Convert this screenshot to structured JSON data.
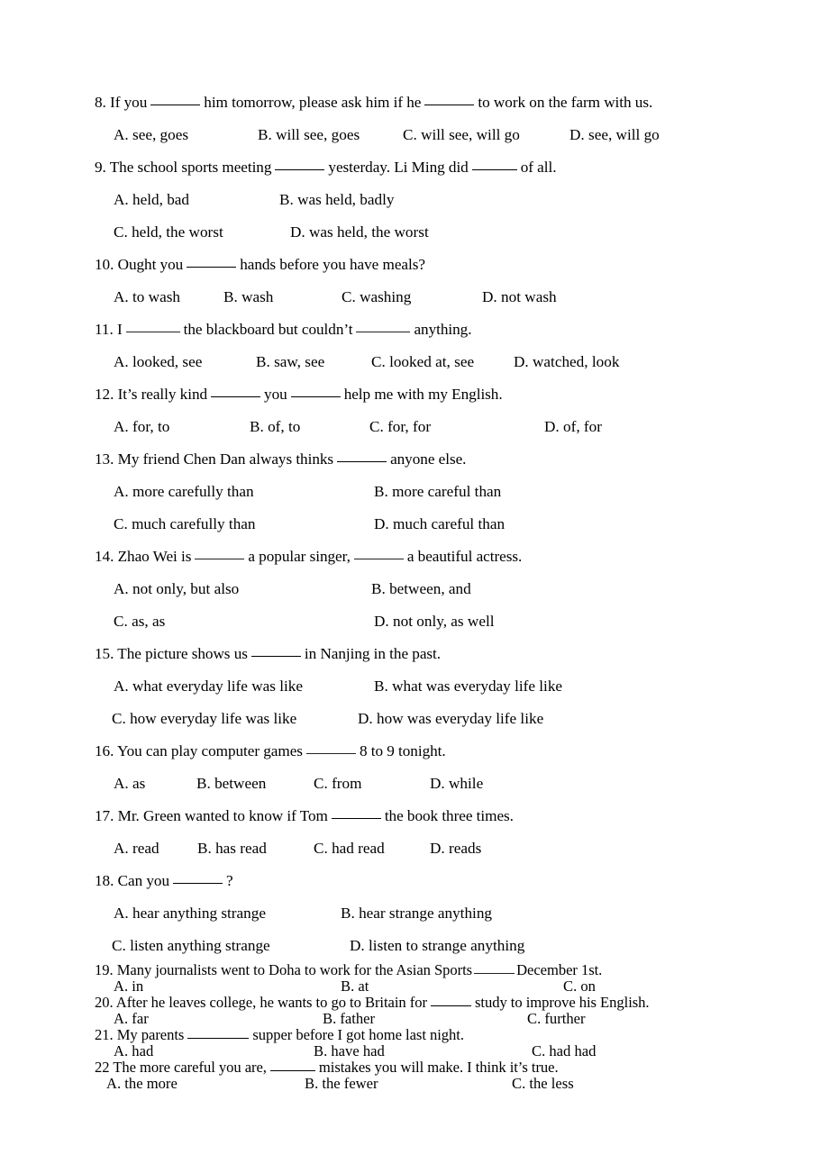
{
  "document": {
    "type": "english-grammar-multiple-choice-worksheet",
    "page_background": "#ffffff",
    "text_color": "#000000"
  },
  "questions": [
    {
      "number": "8.",
      "stem_before": "If you",
      "stem_mid": "him tomorrow, please ask him if he",
      "stem_after": "to work on the farm with us.",
      "layout": "four-column",
      "options": [
        {
          "label": "A.",
          "text": "see, goes"
        },
        {
          "label": "B.",
          "text": "will see, goes"
        },
        {
          "label": "C.",
          "text": "will see, will go"
        },
        {
          "label": "D.",
          "text": "see, will go"
        }
      ]
    },
    {
      "number": "9.",
      "stem_before": "The school sports meeting",
      "stem_mid": "yesterday. Li Ming did",
      "stem_after": "of all.",
      "layout": "two-column-narrow",
      "options": [
        {
          "label": "A.",
          "text": "held, bad"
        },
        {
          "label": "B.",
          "text": "was held, badly"
        },
        {
          "label": "C.",
          "text": "held, the worst"
        },
        {
          "label": "D.",
          "text": "was held, the worst"
        }
      ]
    },
    {
      "number": "10.",
      "stem_before": "Ought you",
      "stem_after": "hands before you have meals?",
      "layout": "four-column",
      "options": [
        {
          "label": "A.",
          "text": "to wash"
        },
        {
          "label": "B.",
          "text": "wash"
        },
        {
          "label": "C.",
          "text": "washing"
        },
        {
          "label": "D.",
          "text": "not wash"
        }
      ]
    },
    {
      "number": "11.",
      "stem_before": "I",
      "stem_mid": "the blackboard but couldn’t",
      "stem_after": "anything.",
      "layout": "four-column",
      "options": [
        {
          "label": "A.",
          "text": "looked, see"
        },
        {
          "label": "B.",
          "text": "saw, see"
        },
        {
          "label": "C.",
          "text": "looked at, see"
        },
        {
          "label": "D.",
          "text": "watched, look"
        }
      ]
    },
    {
      "number": "12.",
      "stem_before": "It’s really kind",
      "stem_mid": "you",
      "stem_after": "help me with my English.",
      "layout": "four-column",
      "options": [
        {
          "label": "A.",
          "text": "for, to"
        },
        {
          "label": "B.",
          "text": "of, to"
        },
        {
          "label": "C.",
          "text": "for, for"
        },
        {
          "label": "D.",
          "text": "of, for"
        }
      ]
    },
    {
      "number": "13.",
      "stem_before": "My friend Chen Dan always thinks",
      "stem_after": "anyone else.",
      "layout": "two-column-wide",
      "options": [
        {
          "label": "A.",
          "text": "more carefully than"
        },
        {
          "label": "B.",
          "text": "more careful than"
        },
        {
          "label": "C.",
          "text": "much carefully than"
        },
        {
          "label": "D.",
          "text": "much careful than"
        }
      ]
    },
    {
      "number": "14.",
      "stem_before": "Zhao Wei is",
      "stem_mid": "a popular singer,",
      "stem_after": "a beautiful actress.",
      "layout": "two-column-wide",
      "options": [
        {
          "label": "A.",
          "text": "not only, but also"
        },
        {
          "label": "B.",
          "text": "between, and"
        },
        {
          "label": "C.",
          "text": "as, as"
        },
        {
          "label": "D.",
          "text": "not only, as well"
        }
      ]
    },
    {
      "number": "15.",
      "stem_before": "The picture shows us",
      "stem_after": "in Nanjing in the past.",
      "layout": "two-column-wide",
      "options": [
        {
          "label": "A.",
          "text": "what everyday life was like"
        },
        {
          "label": "B.",
          "text": "what was everyday life like"
        },
        {
          "label": "C.",
          "text": "how everyday life was like"
        },
        {
          "label": "D.",
          "text": "how was everyday life like"
        }
      ]
    },
    {
      "number": "16.",
      "stem_before": "You can play computer games",
      "stem_after": "8 to 9 tonight.",
      "layout": "four-column",
      "options": [
        {
          "label": "A.",
          "text": "as"
        },
        {
          "label": "B.",
          "text": "between"
        },
        {
          "label": "C.",
          "text": "from"
        },
        {
          "label": "D.",
          "text": "while"
        }
      ]
    },
    {
      "number": "17.",
      "stem_before": "Mr. Green wanted to know if Tom",
      "stem_after": "the book three times.",
      "layout": "four-column",
      "options": [
        {
          "label": "A.",
          "text": "read"
        },
        {
          "label": "B.",
          "text": "has read"
        },
        {
          "label": "C.",
          "text": "had read"
        },
        {
          "label": "D.",
          "text": "reads"
        }
      ]
    },
    {
      "number": "18.",
      "stem_before": "Can you",
      "stem_after": "?",
      "layout": "two-column-wide",
      "options": [
        {
          "label": "A.",
          "text": "hear anything strange"
        },
        {
          "label": "B.",
          "text": "hear strange anything"
        },
        {
          "label": "C.",
          "text": "listen anything strange"
        },
        {
          "label": "D.",
          "text": "listen to strange anything"
        }
      ]
    },
    {
      "number": "19.",
      "stem_before": "Many journalists went to Doha to work for the Asian Sports",
      "stem_after": "December 1st.",
      "layout": "three-column-dense",
      "options": [
        {
          "label": "A.",
          "text": "in"
        },
        {
          "label": "B.",
          "text": "at"
        },
        {
          "label": "C.",
          "text": "on"
        }
      ]
    },
    {
      "number": "20.",
      "stem_before": "After he leaves college, he wants to go to Britain for",
      "stem_after": "study to improve his English.",
      "layout": "three-column-dense",
      "options": [
        {
          "label": "A.",
          "text": "far"
        },
        {
          "label": "B.",
          "text": "father"
        },
        {
          "label": "C.",
          "text": "further"
        }
      ]
    },
    {
      "number": "21.",
      "stem_before": "My parents",
      "stem_after": "supper before I got home last night.",
      "layout": "three-column-dense",
      "options": [
        {
          "label": "A.",
          "text": "had"
        },
        {
          "label": "B.",
          "text": "have had"
        },
        {
          "label": "C.",
          "text": "had had"
        }
      ]
    },
    {
      "number": "22",
      "stem_before": "The more careful you are,",
      "stem_after": "mistakes you will make. I think it’s true.",
      "layout": "three-column-dense",
      "options": [
        {
          "label": "A.",
          "text": "the more"
        },
        {
          "label": "B.",
          "text": "the fewer"
        },
        {
          "label": "C.",
          "text": "the less"
        }
      ]
    }
  ]
}
